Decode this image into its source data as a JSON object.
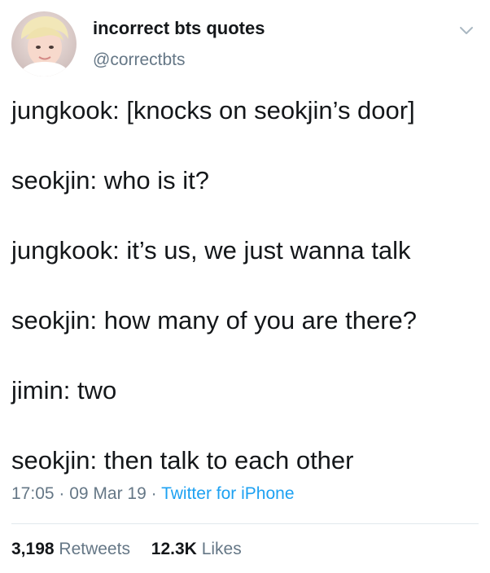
{
  "header": {
    "display_name": "incorrect bts quotes",
    "handle": "@correctbts",
    "menu_icon": "chevron-down-icon",
    "avatar_icon": "profile-photo"
  },
  "tweet_lines": [
    "jungkook: [knocks on seokjin’s door]",
    "seokjin: who is it?",
    "jungkook: it’s us, we just wanna talk",
    "seokjin: how many of you are there?",
    "jimin: two",
    "seokjin: then talk to each other"
  ],
  "meta": {
    "time": "17:05",
    "sep1": " · ",
    "date": "09 Mar 19",
    "sep2": " · ",
    "source": "Twitter for iPhone"
  },
  "stats": {
    "retweets_count": "3,198",
    "retweets_label": "Retweets",
    "likes_count": "12.3K",
    "likes_label": "Likes"
  },
  "colors": {
    "text": "#14171a",
    "secondary": "#657786",
    "link": "#1da1f2",
    "divider": "#e1e8ed"
  }
}
